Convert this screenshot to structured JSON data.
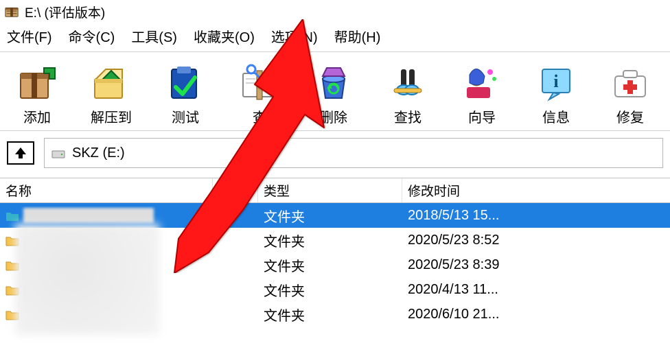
{
  "title": "E:\\ (评估版本)",
  "menu": {
    "file": "文件(F)",
    "command": "命令(C)",
    "tools": "工具(S)",
    "favorites": "收藏夹(O)",
    "options": "选项(N)",
    "help": "帮助(H)"
  },
  "toolbar": {
    "add": "添加",
    "extract_to": "解压到",
    "test": "测试",
    "view": "查",
    "delete": "删除",
    "find": "查找",
    "wizard": "向导",
    "info": "信息",
    "repair": "修复"
  },
  "address": {
    "label": "SKZ (E:)"
  },
  "columns": {
    "name": "名称",
    "size": "",
    "type": "类型",
    "modified": "修改时间"
  },
  "rows": [
    {
      "type": "文件夹",
      "modified": "2018/5/13 15...",
      "selected": true
    },
    {
      "type": "文件夹",
      "modified": "2020/5/23 8:52",
      "selected": false
    },
    {
      "type": "文件夹",
      "modified": "2020/5/23 8:39",
      "selected": false
    },
    {
      "type": "文件夹",
      "modified": "2020/4/13 11...",
      "selected": false
    },
    {
      "type": "文件夹",
      "modified": "2020/6/10 21...",
      "selected": false
    }
  ],
  "icons": {
    "add": "add",
    "extract_to": "extract",
    "test": "test",
    "view": "view",
    "delete": "delete",
    "find": "find",
    "wizard": "wizard",
    "info": "info",
    "repair": "repair"
  }
}
